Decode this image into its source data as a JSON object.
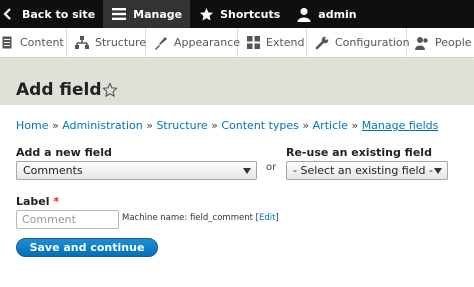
{
  "toolbar": {
    "back_label": "Back to site",
    "manage_label": "Manage",
    "shortcuts_label": "Shortcuts",
    "user_label": "admin"
  },
  "tray": {
    "items": [
      {
        "label": "Content",
        "icon": "content-icon"
      },
      {
        "label": "Structure",
        "icon": "structure-icon"
      },
      {
        "label": "Appearance",
        "icon": "appearance-icon"
      },
      {
        "label": "Extend",
        "icon": "extend-icon"
      },
      {
        "label": "Configuration",
        "icon": "configuration-icon"
      },
      {
        "label": "People",
        "icon": "people-icon"
      }
    ]
  },
  "page": {
    "title": "Add field"
  },
  "breadcrumb": {
    "items": [
      "Home",
      "Administration",
      "Structure",
      "Content types",
      "Article",
      "Manage fields"
    ],
    "separator": "»"
  },
  "form": {
    "new_field_label": "Add a new field",
    "new_field_value": "Comments",
    "or_text": "or",
    "reuse_label": "Re-use an existing field",
    "reuse_value": "- Select an existing field -",
    "label_label": "Label",
    "required_mark": "*",
    "label_value": "Comment",
    "machine_name_prefix": "Machine name: field_comment [",
    "machine_name_edit": "Edit",
    "machine_name_suffix": "]",
    "submit_label": "Save and continue"
  },
  "colors": {
    "toolbar_bg": "#0f0f0f",
    "link": "#0074bd",
    "button": "#0071b8",
    "header_band": "#e0e0d8",
    "required": "#e62600"
  }
}
